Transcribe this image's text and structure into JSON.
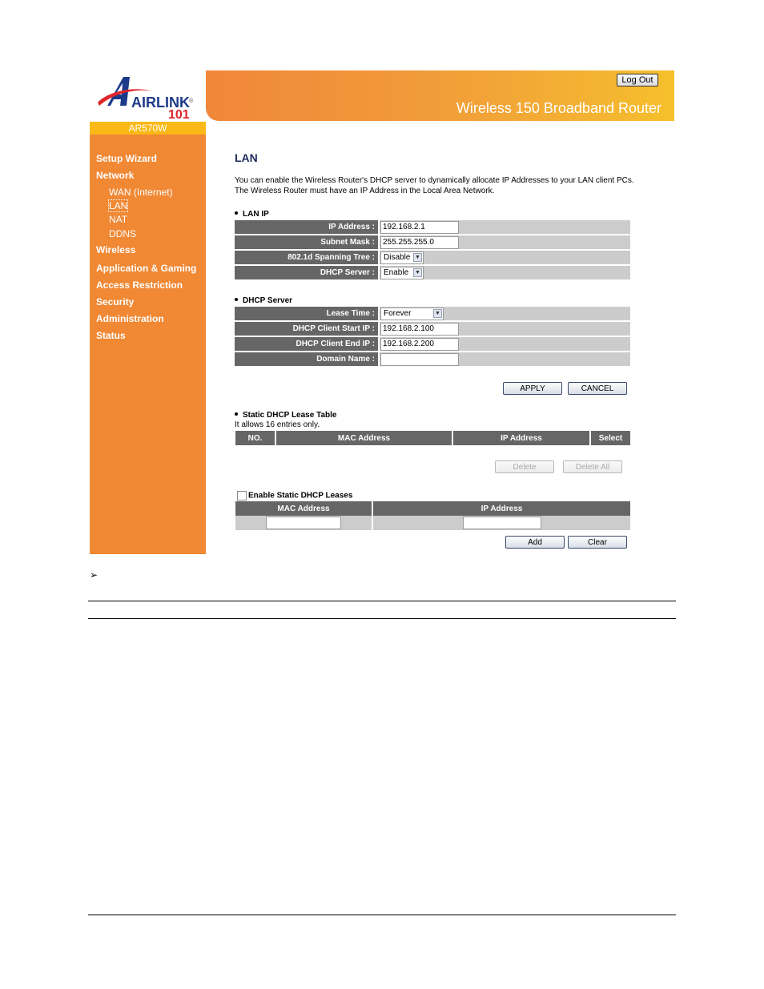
{
  "brand": {
    "logo_text": "AIRLINK",
    "logo_number": "101",
    "registered_mark": "®",
    "model": "AR570W"
  },
  "header": {
    "product_title": "Wireless 150 Broadband Router",
    "logout_label": "Log Out",
    "gradient_colors": [
      "#f0873a",
      "#f6c02b"
    ]
  },
  "sidebar": {
    "color": "#f08834",
    "items": [
      {
        "label": "Setup Wizard",
        "level": 0
      },
      {
        "label": "Network",
        "level": 0
      },
      {
        "label": "WAN (Internet)",
        "level": 1
      },
      {
        "label": "LAN",
        "level": 1,
        "active": true
      },
      {
        "label": "NAT",
        "level": 1
      },
      {
        "label": "DDNS",
        "level": 1
      },
      {
        "label": "Wireless",
        "level": 0
      },
      {
        "label": "Application & Gaming",
        "level": 0
      },
      {
        "label": "Access Restriction",
        "level": 0
      },
      {
        "label": "Security",
        "level": 0
      },
      {
        "label": "Administration",
        "level": 0
      },
      {
        "label": "Status",
        "level": 0
      }
    ]
  },
  "main": {
    "title": "LAN",
    "description_line1": "You can enable the Wireless Router's DHCP server to dynamically allocate IP Addresses to your LAN client PCs.",
    "description_line2": "The Wireless Router must have an IP Address in the Local Area Network.",
    "lan_ip": {
      "heading": "LAN IP",
      "ip_address_label": "IP Address :",
      "ip_address_value": "192.168.2.1",
      "subnet_mask_label": "Subnet Mask :",
      "subnet_mask_value": "255.255.255.0",
      "spanning_tree_label": "802.1d Spanning Tree :",
      "spanning_tree_value": "Disable",
      "dhcp_server_label": "DHCP Server :",
      "dhcp_server_value": "Enable"
    },
    "dhcp_server": {
      "heading": "DHCP Server",
      "lease_time_label": "Lease Time :",
      "lease_time_value": "Forever",
      "start_ip_label": "DHCP Client Start IP :",
      "start_ip_value": "192.168.2.100",
      "end_ip_label": "DHCP Client End IP :",
      "end_ip_value": "192.168.2.200",
      "domain_name_label": "Domain Name :",
      "domain_name_value": ""
    },
    "apply_label": "APPLY",
    "cancel_label": "CANCEL",
    "static_table": {
      "heading": "Static DHCP Lease Table",
      "note": "It allows 16 entries only.",
      "columns": [
        "NO.",
        "MAC Address",
        "IP Address",
        "Select"
      ],
      "rows": [],
      "delete_label": "Delete",
      "delete_all_label": "Delete All"
    },
    "static_add": {
      "enable_label": "Enable Static DHCP Leases",
      "enabled": false,
      "columns": [
        "MAC Address",
        "IP Address"
      ],
      "mac_value": "",
      "ip_value": "",
      "add_label": "Add",
      "clear_label": "Clear"
    }
  },
  "document": {
    "arrow_bullet": "➢"
  }
}
